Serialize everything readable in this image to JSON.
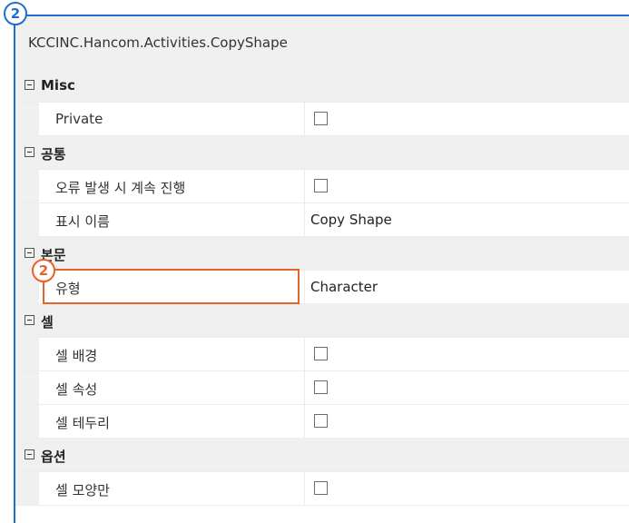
{
  "badge_top": "2",
  "badge_highlight": "2",
  "header": {
    "title": "KCCINC.Hancom.Activities.CopyShape"
  },
  "categories": {
    "misc": "Misc",
    "common": "공통",
    "body": "본문",
    "cell": "셀",
    "options": "옵션"
  },
  "properties": {
    "private": {
      "label": "Private",
      "checked": false
    },
    "continue_on_error": {
      "label": "오류 발생 시 계속 진행",
      "checked": false
    },
    "display_name": {
      "label": "표시 이름",
      "value": "Copy Shape"
    },
    "type": {
      "label": "유형",
      "value": "Character"
    },
    "cell_background": {
      "label": "셀 배경",
      "checked": false
    },
    "cell_attributes": {
      "label": "셀 속성",
      "checked": false
    },
    "cell_border": {
      "label": "셀 테두리",
      "checked": false
    },
    "cell_shape_only": {
      "label": "셀 모양만",
      "checked": false
    }
  },
  "colors": {
    "accent_blue": "#1f6fd1",
    "highlight_orange": "#e8632a"
  }
}
